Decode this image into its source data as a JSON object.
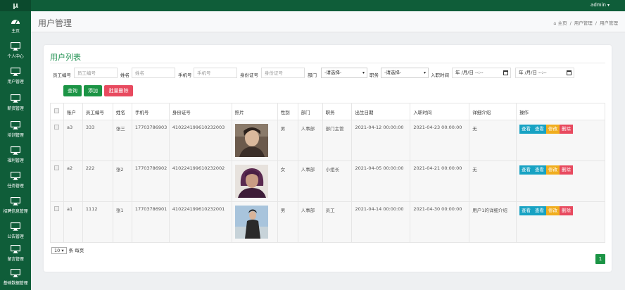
{
  "app": {
    "logo": "μ",
    "user": "admin"
  },
  "sidebar": {
    "items": [
      {
        "label": "主页",
        "icon": "dashboard-icon"
      },
      {
        "label": "个人中心",
        "icon": "monitor-icon"
      },
      {
        "label": "用户管理",
        "icon": "monitor-icon"
      },
      {
        "label": "薪资管理",
        "icon": "monitor-icon"
      },
      {
        "label": "培训管理",
        "icon": "monitor-icon"
      },
      {
        "label": "福利管理",
        "icon": "monitor-icon"
      },
      {
        "label": "任务管理",
        "icon": "monitor-icon"
      },
      {
        "label": "招聘信息管理",
        "icon": "monitor-icon"
      },
      {
        "label": "公告管理",
        "icon": "monitor-icon"
      },
      {
        "label": "留言管理",
        "icon": "monitor-icon"
      },
      {
        "label": "基础数据管理",
        "icon": "monitor-icon"
      }
    ]
  },
  "header": {
    "title": "用户管理",
    "breadcrumb": [
      "主页",
      "用户管理",
      "用户管理"
    ]
  },
  "card": {
    "title": "用户列表"
  },
  "filters": {
    "emp_no_label": "员工编号",
    "emp_no_placeholder": "员工编号",
    "name_label": "姓名",
    "name_placeholder": "姓名",
    "phone_label": "手机号",
    "phone_placeholder": "手机号",
    "id_label": "身份证号",
    "id_placeholder": "身份证号",
    "dept_label": "部门",
    "dept_value": "-请选择-",
    "position_label": "职务",
    "position_value": "-请选择-",
    "hire_label": "入职时间",
    "date_from": "年 /月/日 --:--",
    "date_to": "年 /月/日 --:--"
  },
  "buttons": {
    "search": "查询",
    "add": "添加",
    "batch_delete": "批量删除"
  },
  "table": {
    "headers": [
      "账户",
      "员工编号",
      "姓名",
      "手机号",
      "身份证号",
      "照片",
      "性别",
      "部门",
      "职务",
      "出生日期",
      "入职时间",
      "详细介绍",
      "操作"
    ],
    "rows": [
      {
        "account": "a3",
        "emp_no": "333",
        "name": "张三",
        "phone": "17703786903",
        "id_no": "410224199610232003",
        "gender": "男",
        "dept": "人事部",
        "position": "部门主管",
        "birth": "2021-04-12 00:00:00",
        "hire": "2021-04-23 00:00:00",
        "detail": "无"
      },
      {
        "account": "a2",
        "emp_no": "222",
        "name": "张2",
        "phone": "17703786902",
        "id_no": "410224199610232002",
        "gender": "女",
        "dept": "人事部",
        "position": "小组长",
        "birth": "2021-04-05 00:00:00",
        "hire": "2021-04-21 00:00:00",
        "detail": "无"
      },
      {
        "account": "a1",
        "emp_no": "1112",
        "name": "张1",
        "phone": "17703786901",
        "id_no": "410224199610232001",
        "gender": "男",
        "dept": "人事部",
        "position": "员工",
        "birth": "2021-04-14 00:00:00",
        "hire": "2021-04-30 00:00:00",
        "detail": "用户1的详细介绍"
      }
    ],
    "ops": {
      "view1": "查看",
      "view2": "查看",
      "edit": "修改",
      "delete": "删除"
    }
  },
  "pagination": {
    "page_size": "10",
    "page_size_suffix": "条 每页",
    "current_page": "1"
  },
  "colors": {
    "sidebar": "#0f5d39",
    "accent_green": "#1b9445",
    "danger": "#e84a5f",
    "info": "#17a2c3",
    "warning": "#f0ad1e"
  }
}
